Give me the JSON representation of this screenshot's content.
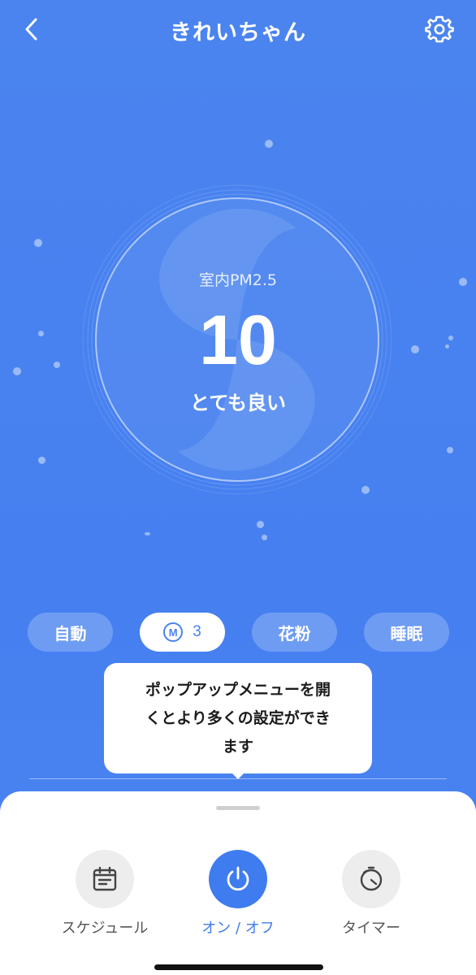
{
  "header": {
    "title": "きれいちゃん",
    "back_icon": "chevron-left-icon",
    "settings_icon": "gear-icon"
  },
  "air_quality": {
    "label": "室内PM2.5",
    "value": "10",
    "status": "とても良い"
  },
  "modes": [
    {
      "label": "自動",
      "active": false
    },
    {
      "label": "3",
      "icon": "M",
      "active": true
    },
    {
      "label": "花粉",
      "active": false
    },
    {
      "label": "睡眠",
      "active": false
    }
  ],
  "tooltip": {
    "line1": "ポップアップメニューを開",
    "line2": "くとより多くの設定ができ",
    "line3": "ます"
  },
  "actions": [
    {
      "label": "スケジュール",
      "icon": "calendar-icon"
    },
    {
      "label": "オン / オフ",
      "icon": "power-icon",
      "active": true
    },
    {
      "label": "タイマー",
      "icon": "timer-icon"
    }
  ],
  "colors": {
    "background": "#4a82ee",
    "accent": "#3f7cef",
    "white": "#ffffff"
  }
}
